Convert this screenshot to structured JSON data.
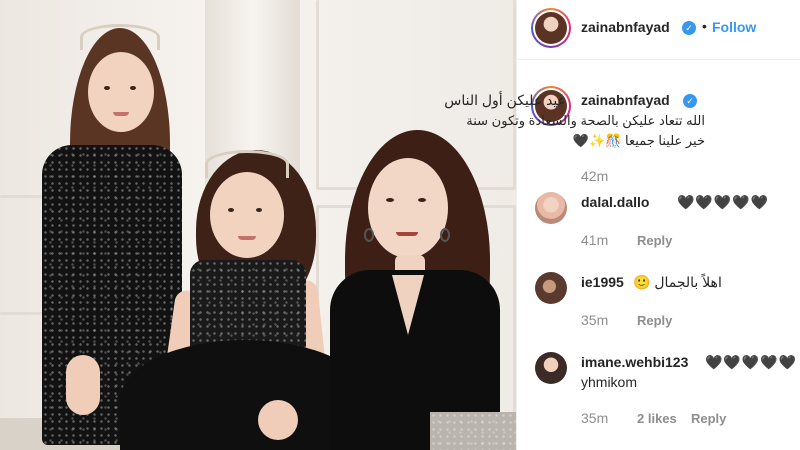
{
  "post": {
    "author": "zainabnfayad",
    "follow_label": "Follow",
    "separator": "•",
    "verified_mark": "✓"
  },
  "caption": {
    "username": "zainabnfayad",
    "line1": "عيد عليكن أول الناس",
    "line2": "الله تتعاد عليكن بالصحة والسعادة وتكون سنة",
    "line3": "خير علينا جميعا 🎊✨🖤",
    "time": "42m"
  },
  "comments": [
    {
      "username": "dalal.dallo",
      "text": "🖤🖤🖤🖤🖤",
      "time": "41m",
      "reply_label": "Reply"
    },
    {
      "username": "ie1995",
      "text": "اهلاً بالجمال 🙂",
      "time": "35m",
      "reply_label": "Reply"
    },
    {
      "username": "imane.wehbi123",
      "text": "🖤🖤🖤🖤🖤 rab",
      "text_line2": "yhmikom",
      "time": "35m",
      "likes": "2 likes",
      "reply_label": "Reply"
    }
  ],
  "colors": {
    "accent": "#3897f0",
    "muted": "#8e8e8e",
    "text": "#262626"
  },
  "icons": {
    "verified": "verified-badge-icon"
  }
}
